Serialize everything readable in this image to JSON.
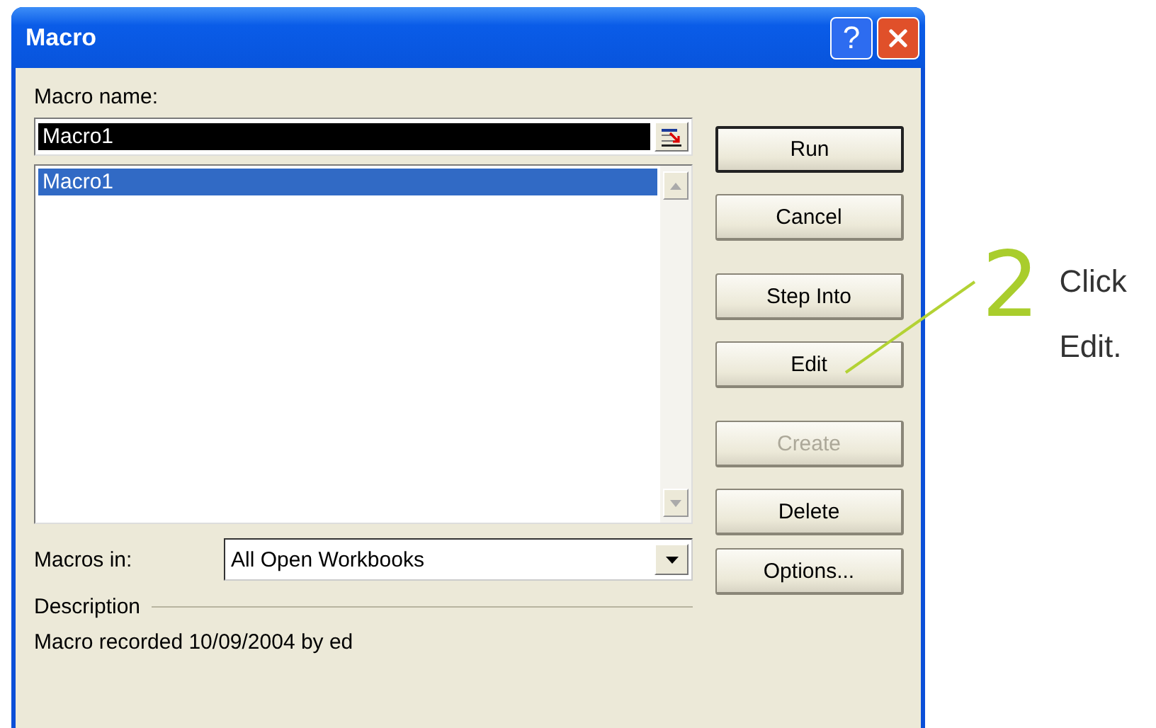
{
  "window": {
    "title": "Macro",
    "help_button": "?"
  },
  "macro_name": {
    "label": "Macro name:",
    "value": "Macro1",
    "text_selected": true
  },
  "macro_list": [
    {
      "label": "Macro1",
      "selected": true
    }
  ],
  "macros_in": {
    "label": "Macros in:",
    "value": "All Open Workbooks"
  },
  "description": {
    "label": "Description",
    "text": "Macro recorded 10/09/2004 by ed"
  },
  "buttons": [
    {
      "label": "Run",
      "default": true,
      "disabled": false
    },
    {
      "label": "Cancel",
      "default": false,
      "disabled": false
    },
    {
      "label": "Step Into",
      "default": false,
      "disabled": false
    },
    {
      "label": "Edit",
      "default": false,
      "disabled": false
    },
    {
      "label": "Create",
      "default": false,
      "disabled": true
    },
    {
      "label": "Delete",
      "default": false,
      "disabled": false
    },
    {
      "label": "Options...",
      "default": false,
      "disabled": false
    }
  ],
  "callout": {
    "step": "2",
    "lines": [
      "Click",
      "Edit."
    ]
  }
}
